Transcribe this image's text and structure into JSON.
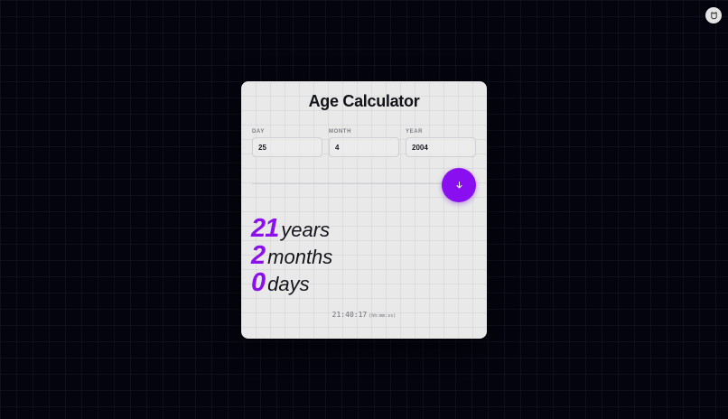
{
  "app": {
    "title": "Age Calculator"
  },
  "form": {
    "day": {
      "label": "DAY",
      "value": "25"
    },
    "month": {
      "label": "MONTH",
      "value": "4"
    },
    "year": {
      "label": "YEAR",
      "value": "2004"
    },
    "submit_icon": "arrow-down-icon"
  },
  "results": {
    "years": {
      "value": "21",
      "unit": "years"
    },
    "months": {
      "value": "2",
      "unit": "months"
    },
    "days": {
      "value": "0",
      "unit": "days"
    }
  },
  "clock": {
    "time": "21:40:17",
    "format": "(hh:mm:ss)"
  },
  "corner_button": {
    "icon": "bear-icon"
  },
  "colors": {
    "accent": "#8a10ec",
    "background": "#04040f",
    "card": "#e9e9e9",
    "text": "#15151c"
  }
}
